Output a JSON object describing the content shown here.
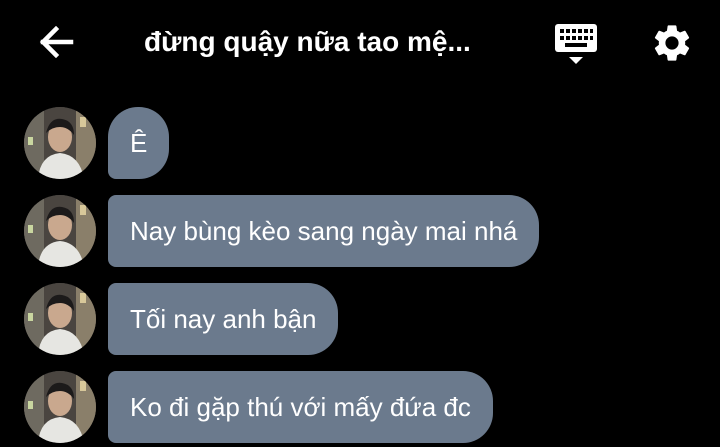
{
  "header": {
    "title": "đừng quậy nữa tao mệ...",
    "back_icon": "arrow-left-icon",
    "keyboard_icon": "keyboard-icon",
    "settings_icon": "gear-icon"
  },
  "messages": [
    {
      "text": "Ê"
    },
    {
      "text": "Nay bùng kèo sang ngày mai nhá"
    },
    {
      "text": "Tối nay anh bận"
    },
    {
      "text": "Ko đi gặp thú với mấy đứa đc"
    }
  ],
  "colors": {
    "background": "#000000",
    "bubble": "#6b7a8d",
    "text": "#ffffff"
  }
}
